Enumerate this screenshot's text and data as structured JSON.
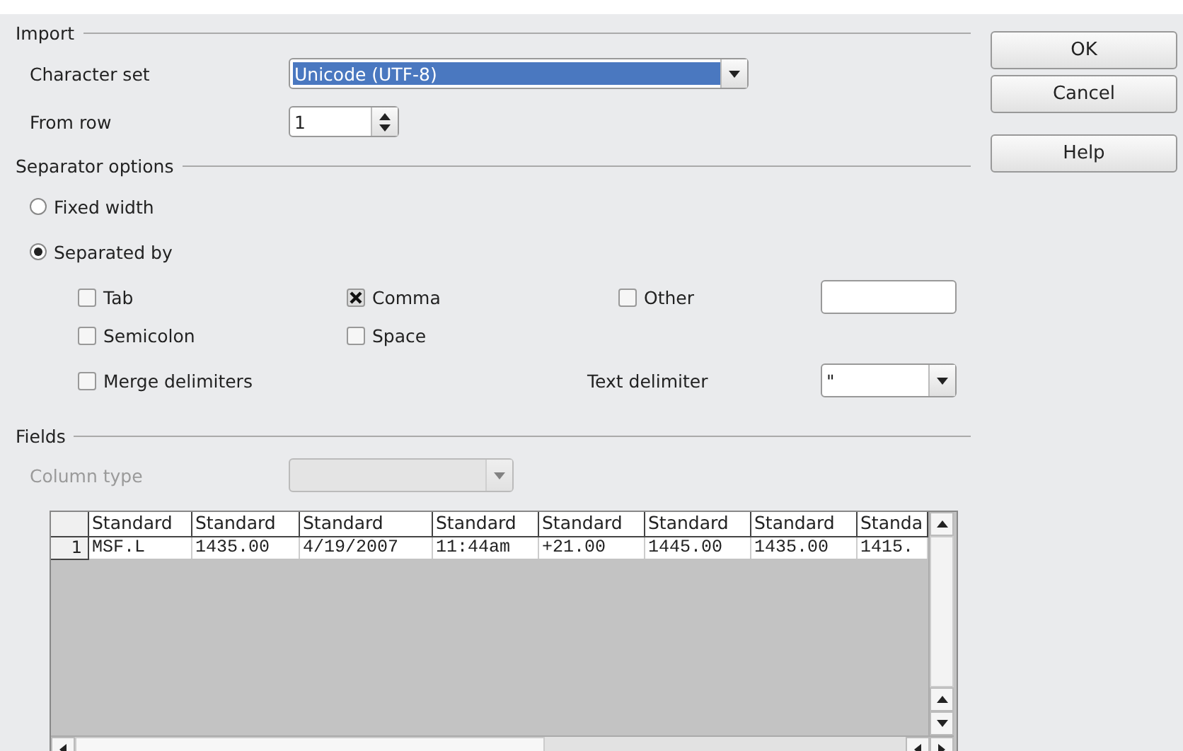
{
  "import": {
    "title": "Import",
    "character_set": {
      "label": "Character set",
      "value": "Unicode (UTF-8)"
    },
    "from_row": {
      "label": "From row",
      "value": "1"
    }
  },
  "separator_options": {
    "title": "Separator options",
    "modes": [
      {
        "label": "Fixed width",
        "selected": false
      },
      {
        "label": "Separated by",
        "selected": true
      }
    ],
    "separators": [
      {
        "label": "Tab",
        "checked": false
      },
      {
        "label": "Comma",
        "checked": true
      },
      {
        "label": "Other",
        "checked": false
      },
      {
        "label": "Semicolon",
        "checked": false
      },
      {
        "label": "Space",
        "checked": false
      }
    ],
    "merge_delimiters": {
      "label": "Merge delimiters",
      "checked": false
    },
    "text_delimiter": {
      "label": "Text delimiter",
      "value": "\""
    }
  },
  "fields": {
    "title": "Fields",
    "column_type": {
      "label": "Column type",
      "disabled": true
    },
    "table": {
      "columns": [
        "Standard",
        "Standard",
        "Standard",
        "Standard",
        "Standard",
        "Standard",
        "Standard",
        "Standa"
      ],
      "rows": [
        {
          "number": "1",
          "cells": [
            "MSF.L",
            "1435.00",
            "4/19/2007",
            "11:44am",
            "+21.00",
            "1445.00",
            "1435.00",
            "1415."
          ]
        }
      ]
    }
  },
  "buttons": [
    "OK",
    "Cancel",
    "Help"
  ]
}
